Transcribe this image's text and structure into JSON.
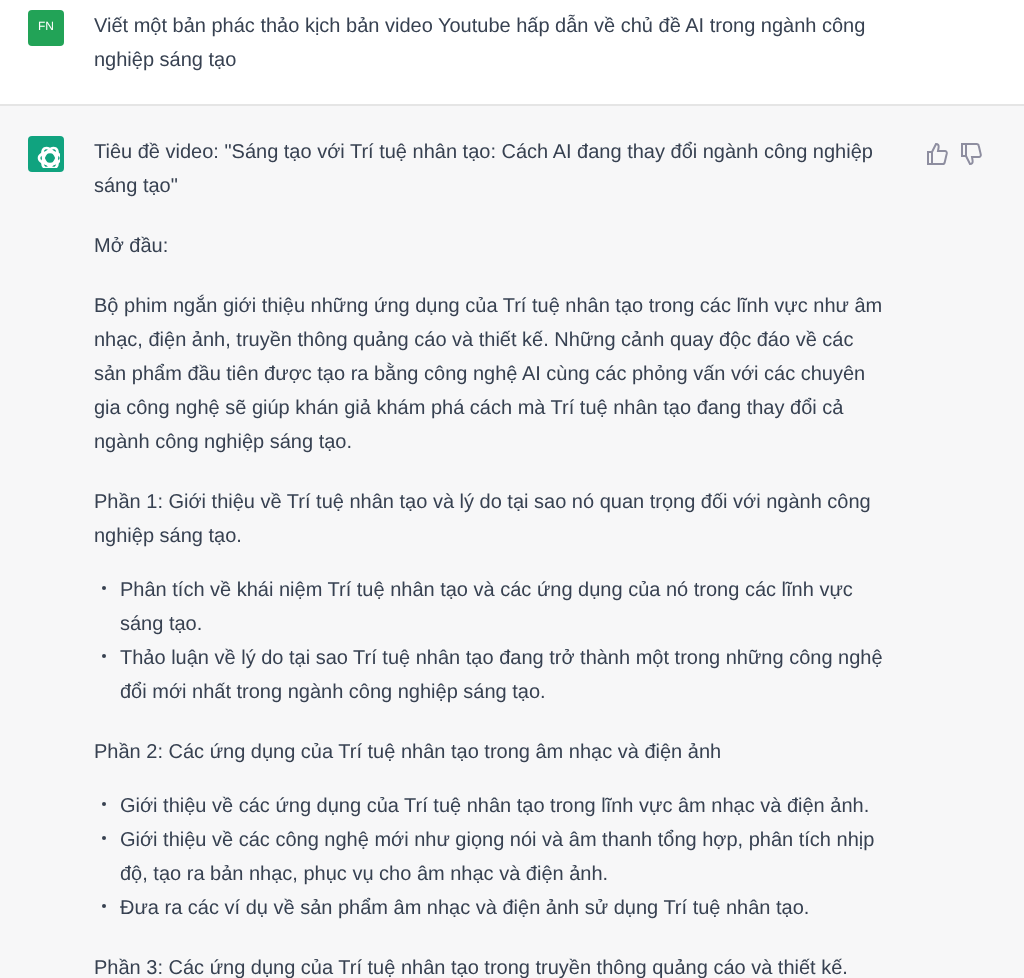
{
  "messages": [
    {
      "kind": "user",
      "avatar": "FN",
      "text": "Viết một bản phác thảo kịch bản video Youtube hấp dẫn về chủ đề AI trong ngành công nghiệp sáng tạo"
    },
    {
      "kind": "assistant",
      "blocks": [
        {
          "kind": "paragraph",
          "text": "Tiêu đề video: \"Sáng tạo với Trí tuệ nhân tạo: Cách AI đang thay đổi ngành công nghiệp sáng tạo\""
        },
        {
          "kind": "paragraph",
          "text": "Mở đầu:"
        },
        {
          "kind": "paragraph",
          "text": "Bộ phim ngắn giới thiệu những ứng dụng của Trí tuệ nhân tạo trong các lĩnh vực như âm nhạc, điện ảnh, truyền thông quảng cáo và thiết kế. Những cảnh quay độc đáo về các sản phẩm đầu tiên được tạo ra bằng công nghệ AI cùng các phỏng vấn với các chuyên gia công nghệ sẽ giúp khán giả khám phá cách mà Trí tuệ nhân tạo đang thay đổi cả ngành công nghiệp sáng tạo."
        },
        {
          "kind": "paragraph",
          "text": "Phần 1: Giới thiệu về Trí tuệ nhân tạo và lý do tại sao nó quan trọng đối với ngành công nghiệp sáng tạo."
        },
        {
          "kind": "bullets",
          "items": [
            "Phân tích về khái niệm Trí tuệ nhân tạo và các ứng dụng của nó trong các lĩnh vực sáng tạo.",
            "Thảo luận về lý do tại sao Trí tuệ nhân tạo đang trở thành một trong những công nghệ đổi mới nhất trong ngành công nghiệp sáng tạo."
          ]
        },
        {
          "kind": "paragraph",
          "text": "Phần 2: Các ứng dụng của Trí tuệ nhân tạo trong âm nhạc và điện ảnh"
        },
        {
          "kind": "bullets",
          "items": [
            "Giới thiệu về các ứng dụng của Trí tuệ nhân tạo trong lĩnh vực âm nhạc và điện ảnh.",
            "Giới thiệu về các công nghệ mới như giọng nói và âm thanh tổng hợp, phân tích nhịp độ, tạo ra bản nhạc, phục vụ cho âm nhạc và điện ảnh.",
            "Đưa ra các ví dụ về sản phẩm âm nhạc và điện ảnh sử dụng Trí tuệ nhân tạo."
          ]
        },
        {
          "kind": "paragraph",
          "text": "Phần 3: Các ứng dụng của Trí tuệ nhân tạo trong truyền thông quảng cáo và thiết kế."
        }
      ]
    }
  ]
}
